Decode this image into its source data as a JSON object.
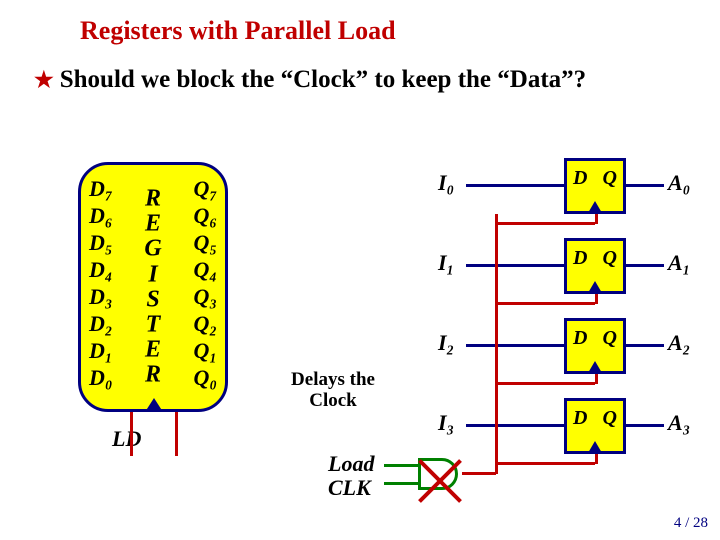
{
  "title": "Registers with Parallel Load",
  "bullet": "Should we block the “Clock” to keep the “Data”?",
  "register": {
    "label_vert": "REGISTER",
    "inputs": [
      "D₇",
      "D₆",
      "D₅",
      "D₄",
      "D₃",
      "D₂",
      "D₁",
      "D₀"
    ],
    "outputs": [
      "Q₇",
      "Q₆",
      "Q₅",
      "Q₄",
      "Q₃",
      "Q₂",
      "Q₁",
      "Q₀"
    ],
    "ld": "LD"
  },
  "annotation": "Delays the Clock",
  "load_clk": [
    "Load",
    "CLK"
  ],
  "ff_rows": [
    {
      "i": "I₀",
      "d": "D",
      "q": "Q",
      "a": "A₀"
    },
    {
      "i": "I₁",
      "d": "D",
      "q": "Q",
      "a": "A₁"
    },
    {
      "i": "I₂",
      "d": "D",
      "q": "Q",
      "a": "A₂"
    },
    {
      "i": "I₃",
      "d": "D",
      "q": "Q",
      "a": "A₃"
    }
  ],
  "page": "4 / 28"
}
